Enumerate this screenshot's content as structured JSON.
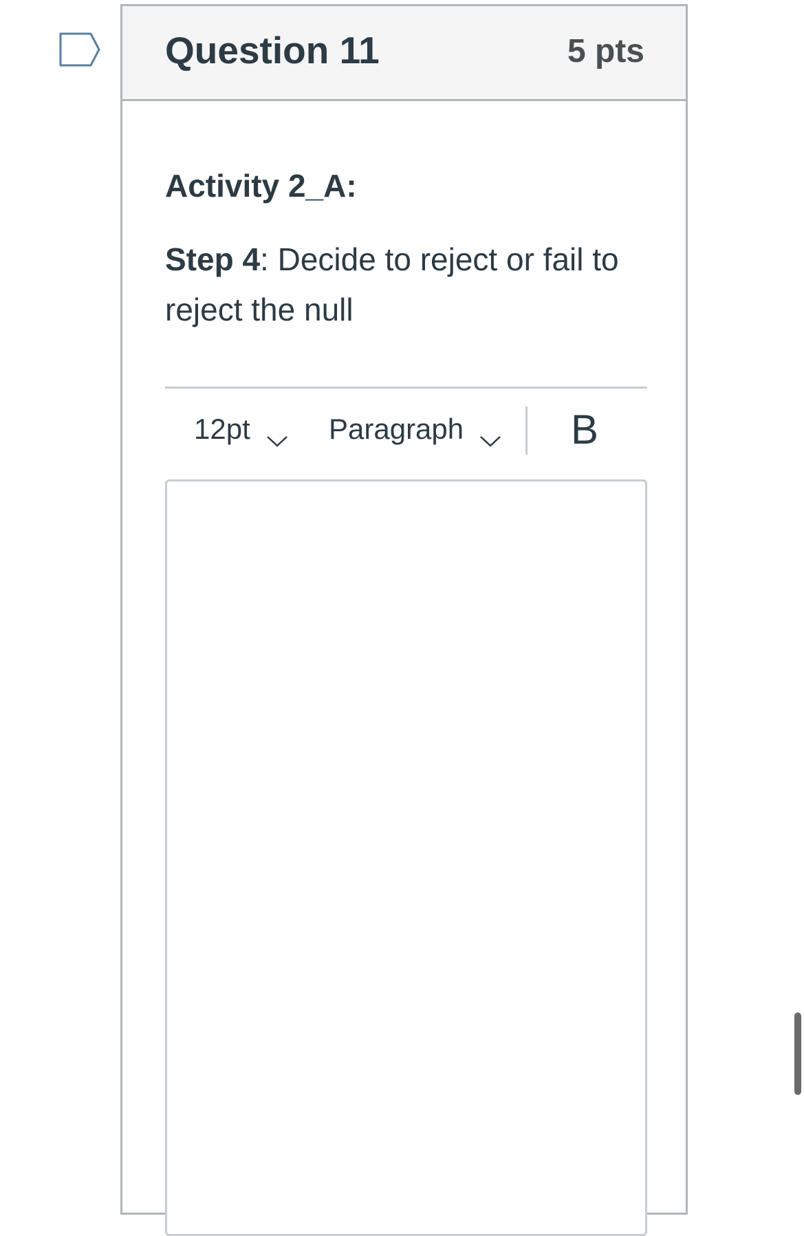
{
  "question": {
    "title": "Question 11",
    "points": "5 pts",
    "flag_icon": "bookmark-flag-icon"
  },
  "content": {
    "activity_title": "Activity 2_A:",
    "step_label": "Step 4",
    "step_text": ": Decide to reject or fail to reject the null"
  },
  "editor": {
    "font_size": "12pt",
    "block_format": "Paragraph",
    "bold_label": "B",
    "value": ""
  },
  "colors": {
    "header_bg": "#f5f5f5",
    "border": "#b0b5b8",
    "text": "#2d3b45",
    "flag": "#5a7fa0"
  }
}
